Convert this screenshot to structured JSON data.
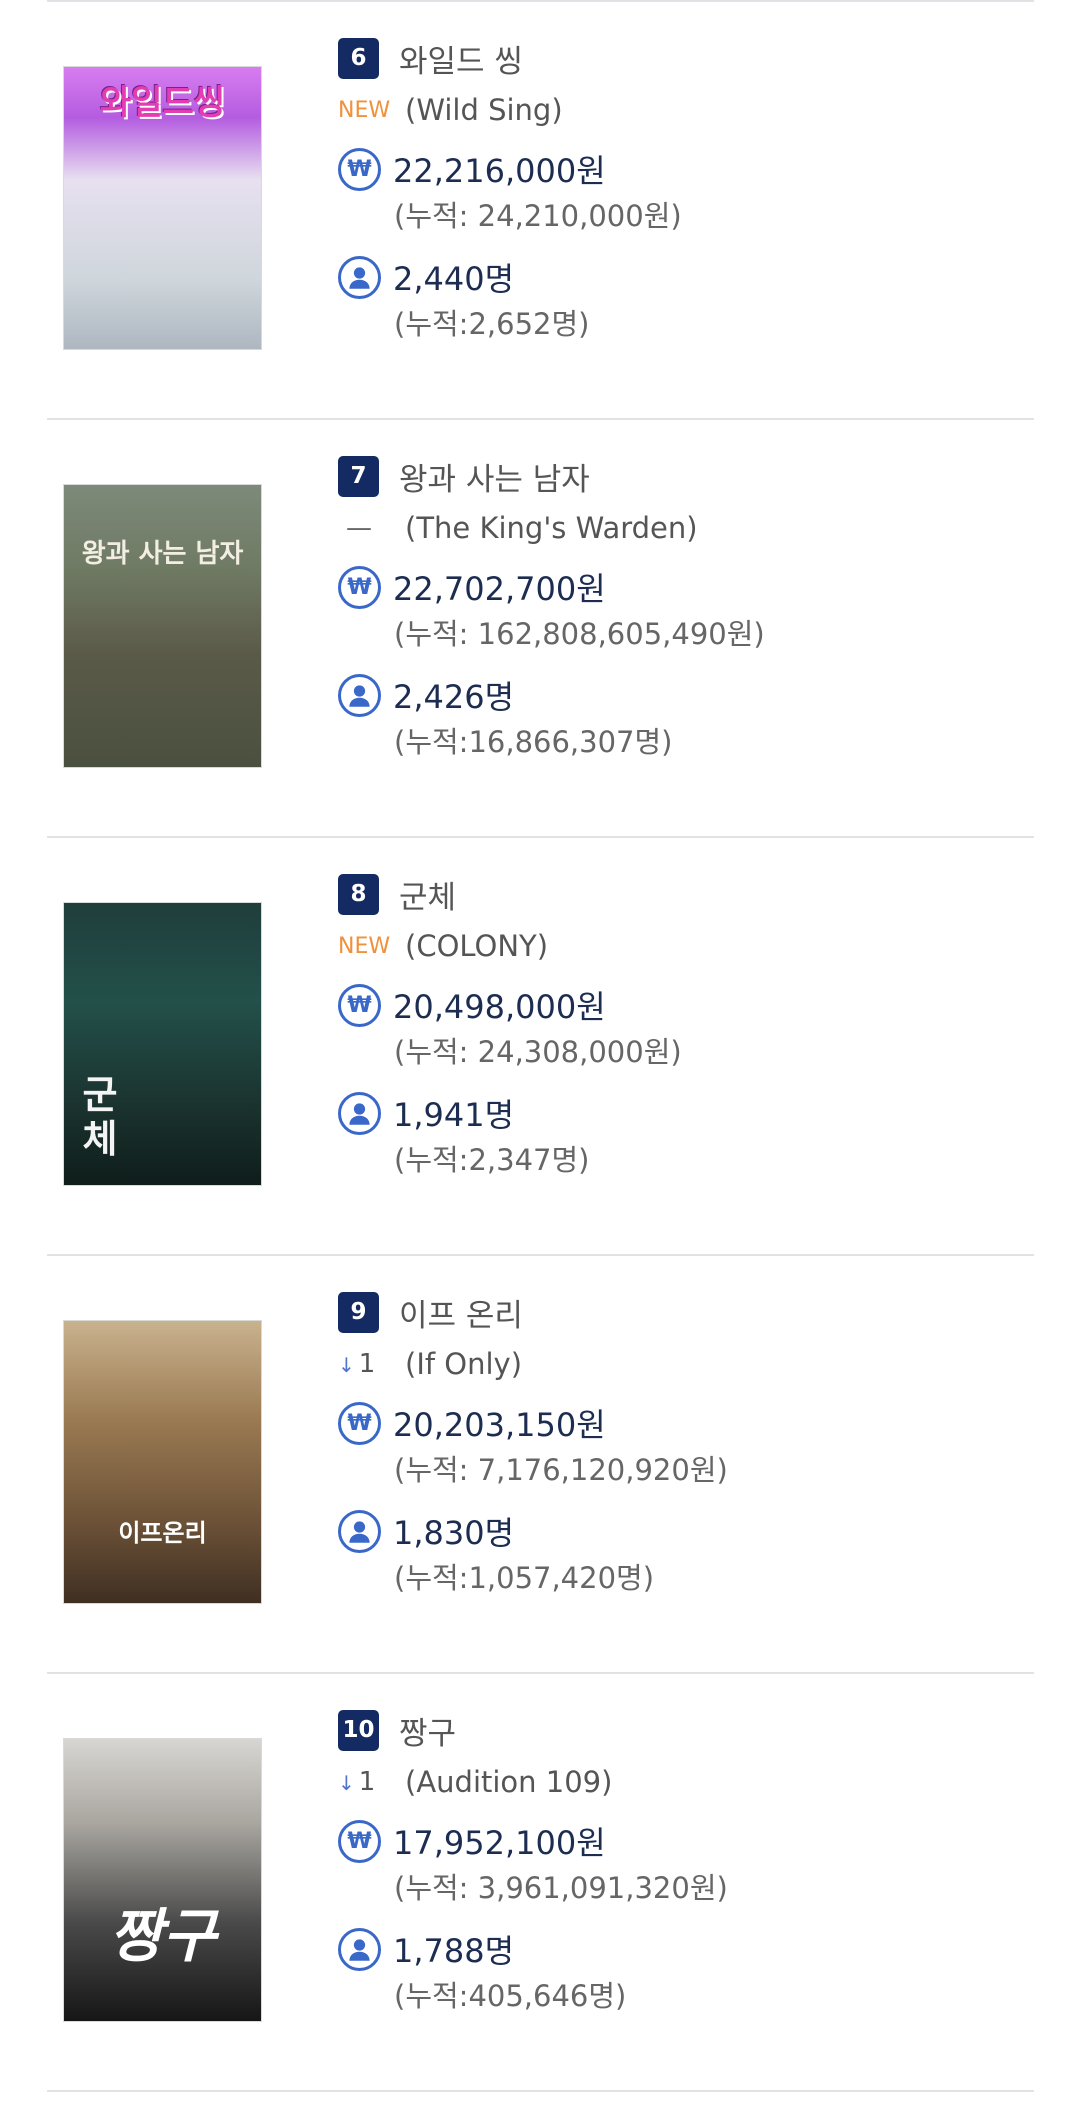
{
  "icons": {
    "revenue": "won-coin-icon",
    "audience": "person-icon"
  },
  "colors": {
    "rank_badge": "#132a62",
    "new_label": "#f0913b",
    "icon_blue": "#3a68c9",
    "divider": "#e1e1e6"
  },
  "entries": [
    {
      "rank": "6",
      "title_ko": "와일드 씽",
      "change": "NEW",
      "change_type": "new",
      "title_en": "(Wild Sing)",
      "revenue": "22,216,000원",
      "revenue_cum": "(누적: 24,210,000원)",
      "audience": "2,440명",
      "audience_cum": "(누적:2,652명)",
      "poster_text": "와일드씽"
    },
    {
      "rank": "7",
      "title_ko": "왕과 사는 남자",
      "change": "—",
      "change_type": "same",
      "title_en": "(The King's Warden)",
      "revenue": "22,702,700원",
      "revenue_cum": "(누적: 162,808,605,490원)",
      "audience": "2,426명",
      "audience_cum": "(누적:16,866,307명)",
      "poster_text": "왕과 사는 남자"
    },
    {
      "rank": "8",
      "title_ko": "군체",
      "change": "NEW",
      "change_type": "new",
      "title_en": "(COLONY)",
      "revenue": "20,498,000원",
      "revenue_cum": "(누적: 24,308,000원)",
      "audience": "1,941명",
      "audience_cum": "(누적:2,347명)",
      "poster_text": "군체"
    },
    {
      "rank": "9",
      "title_ko": "이프 온리",
      "change": "1",
      "change_type": "down",
      "title_en": "(If Only)",
      "revenue": "20,203,150원",
      "revenue_cum": "(누적: 7,176,120,920원)",
      "audience": "1,830명",
      "audience_cum": "(누적:1,057,420명)",
      "poster_text": "이프온리"
    },
    {
      "rank": "10",
      "title_ko": "짱구",
      "change": "1",
      "change_type": "down",
      "title_en": "(Audition 109)",
      "revenue": "17,952,100원",
      "revenue_cum": "(누적: 3,961,091,320원)",
      "audience": "1,788명",
      "audience_cum": "(누적:405,646명)",
      "poster_text": "짱구"
    }
  ]
}
